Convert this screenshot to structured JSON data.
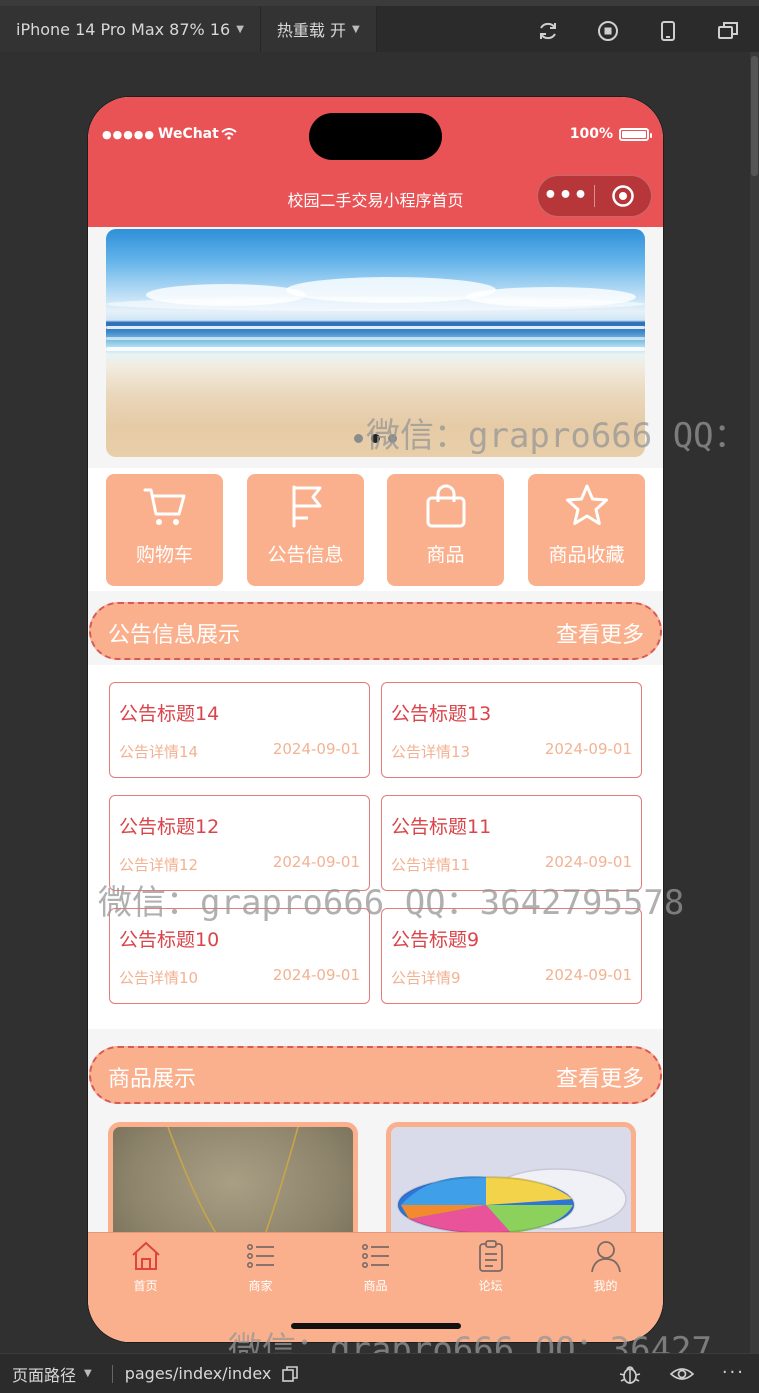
{
  "ide": {
    "device_select": "iPhone 14 Pro Max 87% 16",
    "hot_reload": "热重载 开",
    "page_path_label": "页面路径",
    "page_path_value": "pages/index/index"
  },
  "status_bar": {
    "carrier": "WeChat",
    "battery": "100%"
  },
  "nav": {
    "title": "校园二手交易小程序首页"
  },
  "menu": [
    {
      "label": "购物车",
      "icon": "cart-icon"
    },
    {
      "label": "公告信息",
      "icon": "flag-icon"
    },
    {
      "label": "商品",
      "icon": "bag-icon"
    },
    {
      "label": "商品收藏",
      "icon": "star-icon"
    }
  ],
  "notice_section": {
    "title": "公告信息展示",
    "more": "查看更多",
    "items": [
      {
        "title": "公告标题14",
        "detail": "公告详情14",
        "date": "2024-09-01"
      },
      {
        "title": "公告标题13",
        "detail": "公告详情13",
        "date": "2024-09-01"
      },
      {
        "title": "公告标题12",
        "detail": "公告详情12",
        "date": "2024-09-01"
      },
      {
        "title": "公告标题11",
        "detail": "公告详情11",
        "date": "2024-09-01"
      },
      {
        "title": "公告标题10",
        "detail": "公告详情10",
        "date": "2024-09-01"
      },
      {
        "title": "公告标题9",
        "detail": "公告详情9",
        "date": "2024-09-01"
      }
    ]
  },
  "goods_section": {
    "title": "商品展示",
    "more": "查看更多"
  },
  "tabbar": [
    {
      "label": "首页",
      "icon": "home-icon",
      "active": true
    },
    {
      "label": "商家",
      "icon": "list-icon",
      "active": false
    },
    {
      "label": "商品",
      "icon": "list-icon",
      "active": false
    },
    {
      "label": "论坛",
      "icon": "clipboard-icon",
      "active": false
    },
    {
      "label": "我的",
      "icon": "user-icon",
      "active": false
    }
  ],
  "watermarks": [
    "微信：grapro666 QQ：",
    "微信：grapro666 QQ：3642795578",
    "微信：grapro666 QQ：36427"
  ],
  "colors": {
    "brand_red": "#e95356",
    "peach": "#fbb08d",
    "notice_title": "#d9454a",
    "notice_detail": "#f3b292"
  }
}
